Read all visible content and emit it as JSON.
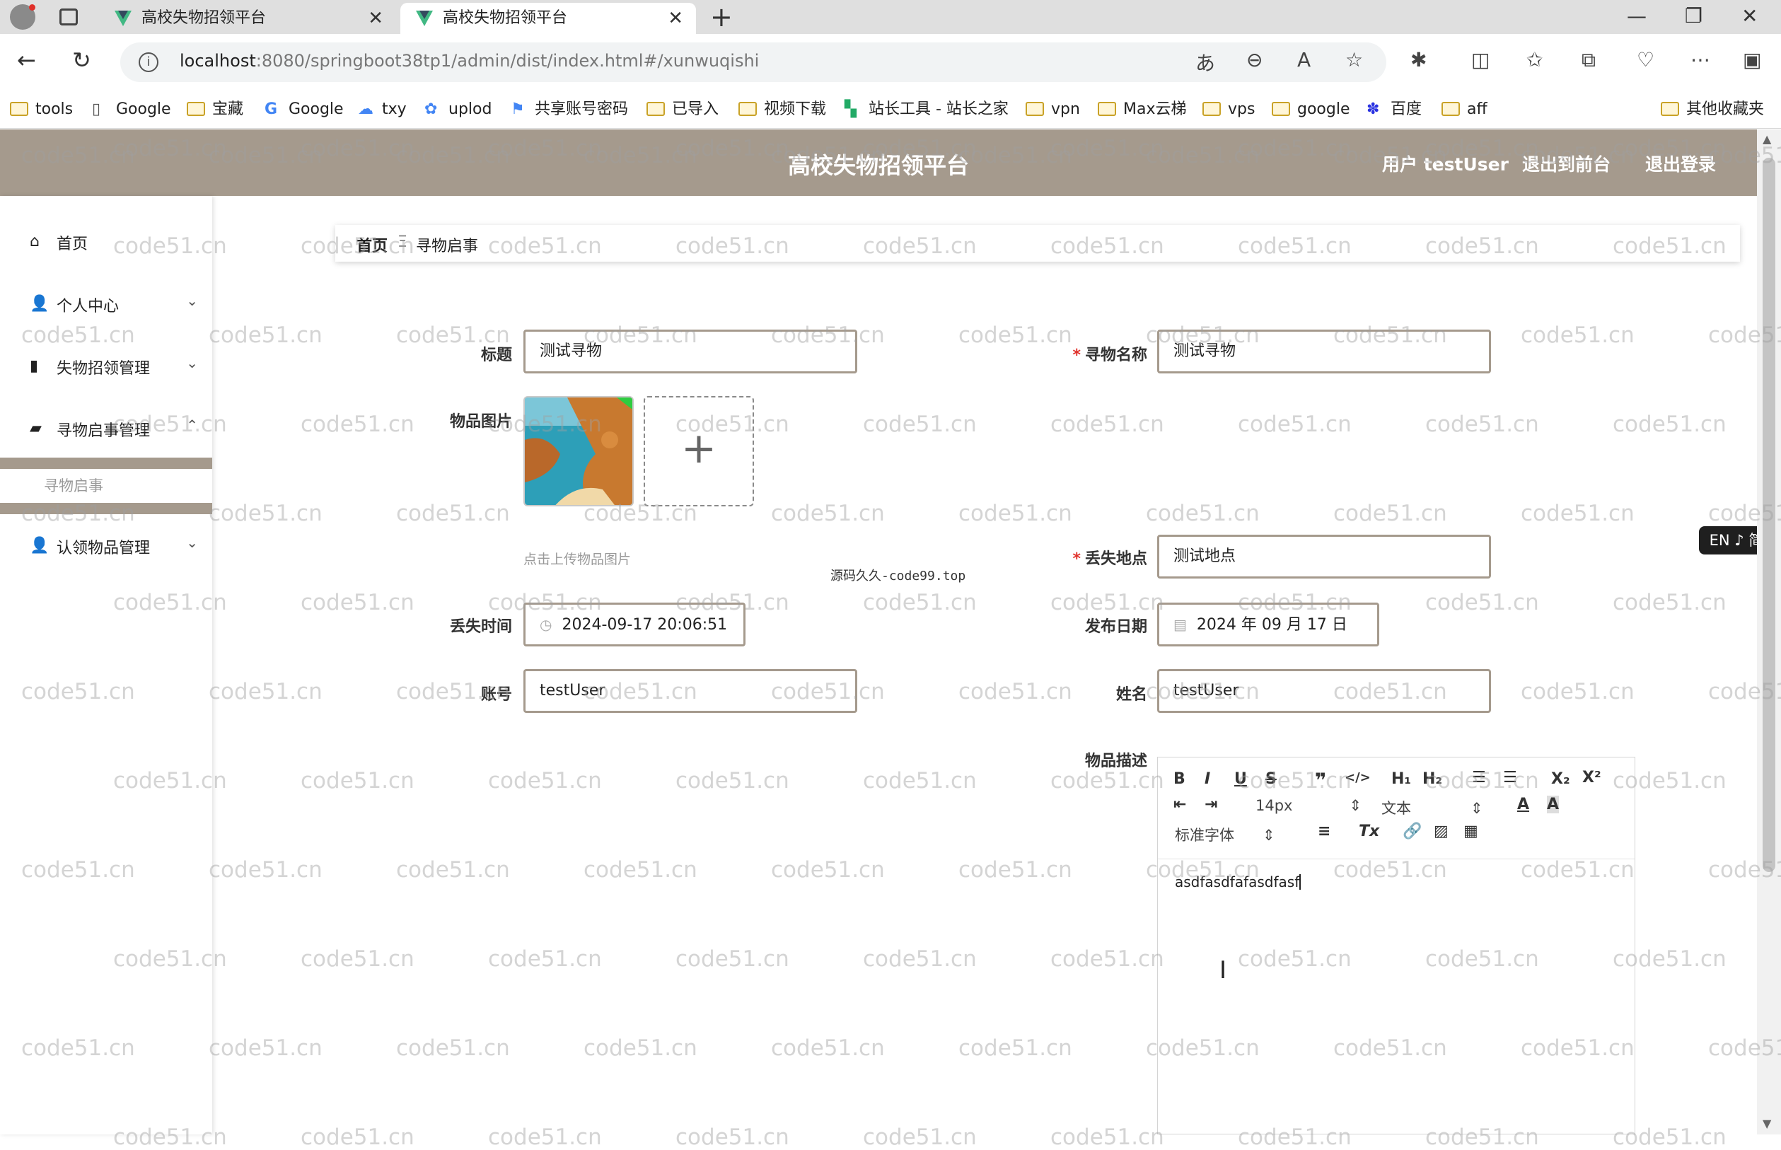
{
  "browser": {
    "tabs": [
      {
        "title": "高校失物招领平台"
      },
      {
        "title": "高校失物招领平台"
      }
    ],
    "url_host": "localhost",
    "url_rest": ":8080/springboot38tp1/admin/dist/index.html#/xunwuqishi",
    "bookmarks": [
      "tools",
      "Google",
      "宝藏",
      "Google",
      "txy",
      "uplod",
      "共享账号密码",
      "已导入",
      "视频下载",
      "站长工具 - 站长之家",
      "vpn",
      "Max云梯",
      "vps",
      "google",
      "百度",
      "aff"
    ],
    "other_bookmarks": "其他收藏夹"
  },
  "header": {
    "title": "高校失物招领平台",
    "user": "用户 testUser",
    "back_to_front": "退出到前台",
    "logout": "退出登录"
  },
  "sidebar": {
    "items": [
      {
        "label": "首页"
      },
      {
        "label": "个人中心"
      },
      {
        "label": "失物招领管理"
      },
      {
        "label": "寻物启事管理"
      },
      {
        "label": "认领物品管理"
      }
    ],
    "submenu": "寻物启事"
  },
  "breadcrumb": {
    "home": "首页",
    "separator": "Ξ",
    "current": "寻物启事"
  },
  "form": {
    "title_label": "标题",
    "title_value": "测试寻物",
    "name_label": "寻物名称",
    "name_value": "测试寻物",
    "image_label": "物品图片",
    "upload_hint": "点击上传物品图片",
    "place_label": "丢失地点",
    "place_value": "测试地点",
    "time_label": "丢失时间",
    "time_value": "2024-09-17 20:06:51",
    "date_label": "发布日期",
    "date_value": "2024 年 09 月 17 日",
    "account_label": "账号",
    "account_value": "testUser",
    "username_label": "姓名",
    "username_value": "testUser",
    "desc_label": "物品描述"
  },
  "watermark_note": "源码久久-code99.top",
  "editor": {
    "font_size": "14px",
    "header_select": "文本",
    "font_family": "标准字体",
    "content": "asdfasdfafasdfasf"
  },
  "lang_badge": "EN ♪ 简",
  "watermark": "code51.cn"
}
